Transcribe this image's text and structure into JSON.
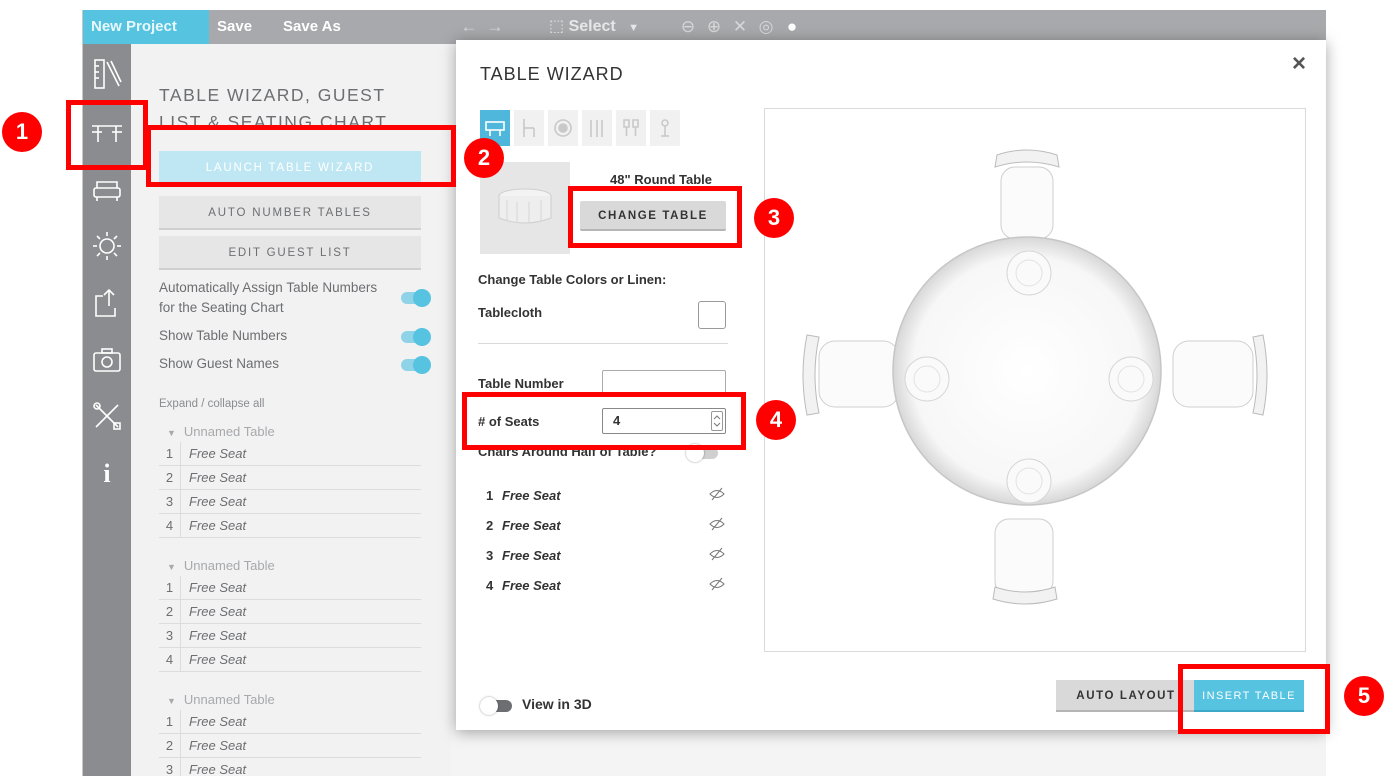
{
  "toolbar": {
    "new_project": "New Project",
    "save": "Save",
    "save_as": "Save As",
    "select": "Select"
  },
  "panel": {
    "title": "TABLE WIZARD, GUEST LIST & SEATING CHART",
    "launch_btn": "LAUNCH TABLE WIZARD",
    "auto_number_btn": "AUTO NUMBER TABLES",
    "edit_guest_btn": "EDIT GUEST LIST",
    "toggles": [
      "Automatically Assign Table Numbers for the Seating Chart",
      "Show Table Numbers",
      "Show Guest Names"
    ],
    "expand_label": "Expand / collapse all",
    "table_name": "Unnamed Table",
    "free_seat": "Free Seat",
    "seat_numbers": [
      "1",
      "2",
      "3",
      "4"
    ]
  },
  "wizard": {
    "title": "TABLE WIZARD",
    "close": "×",
    "table_name": "48\" Round Table",
    "change_btn": "CHANGE TABLE",
    "colors_label": "Change Table Colors or Linen:",
    "tablecloth_label": "Tablecloth",
    "table_number_label": "Table Number",
    "table_number_value": "",
    "seats_label": "# of Seats",
    "seats_value": "4",
    "half_label": "Chairs Around Half of Table?",
    "seats": [
      {
        "num": "1",
        "label": "Free Seat"
      },
      {
        "num": "2",
        "label": "Free Seat"
      },
      {
        "num": "3",
        "label": "Free Seat"
      },
      {
        "num": "4",
        "label": "Free Seat"
      }
    ],
    "view3d_label": "View in 3D",
    "auto_layout_btn": "AUTO LAYOUT",
    "insert_btn": "INSERT TABLE"
  },
  "callouts": [
    "1",
    "2",
    "3",
    "4",
    "5"
  ],
  "colors": {
    "accent": "#56c3e0",
    "highlight": "#ff0000",
    "rail": "#8a8c8f",
    "topbar": "#a7a9ac"
  }
}
